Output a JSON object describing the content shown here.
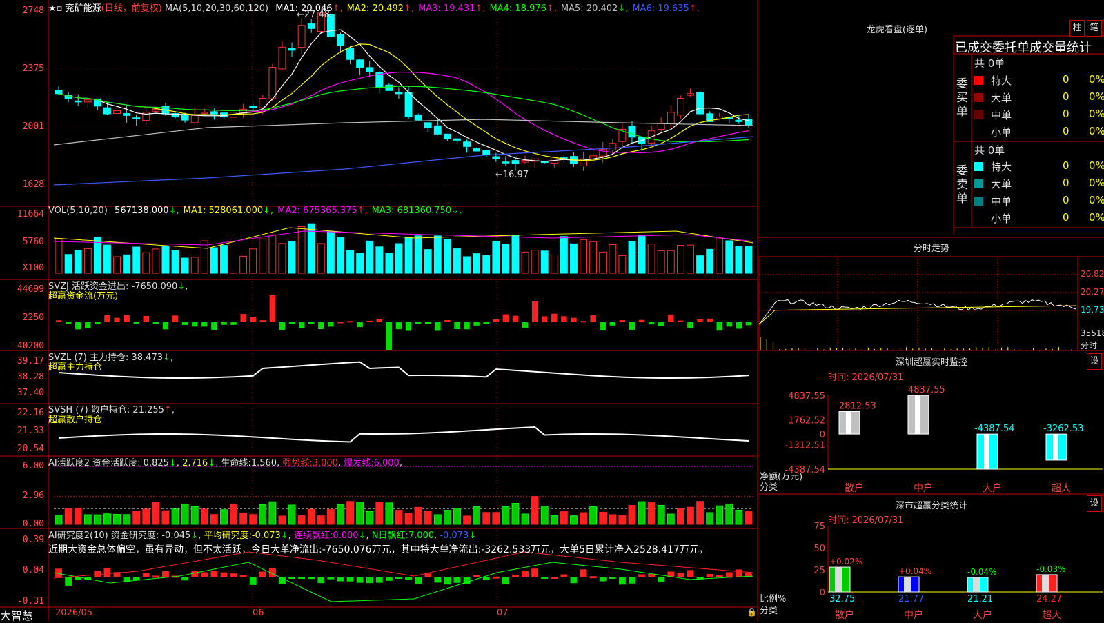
{
  "app": {
    "brand": "大智慧",
    "date_label": "2026/05",
    "month_labels": [
      "06",
      "07"
    ]
  },
  "stock": {
    "name": "兖矿能源",
    "mode": "(日线，前复权)"
  },
  "kline": {
    "ma_header": "MA(5,10,20,30,60,120)",
    "ma_values": [
      {
        "label": "MA1:",
        "value": "20.046",
        "arrow": "↑",
        "color": "#ffffff"
      },
      {
        "label": "MA2:",
        "value": "20.492",
        "arrow": "↑",
        "color": "#ffff00"
      },
      {
        "label": "MA3:",
        "value": "19.431",
        "arrow": "↑",
        "color": "#ff00ff"
      },
      {
        "label": "MA4:",
        "value": "18.976",
        "arrow": "↑",
        "color": "#00ff00"
      },
      {
        "label": "MA5:",
        "value": "20.402",
        "arrow": "↓",
        "color": "#c0c0c0"
      },
      {
        "label": "MA6:",
        "value": "19.635",
        "arrow": "↑",
        "color": "#3a5cff"
      }
    ],
    "high_label": "27.48",
    "low_label": "16.97",
    "y_ticks": [
      "2748",
      "2375",
      "2001",
      "1628"
    ]
  },
  "volume": {
    "header": "VOL(5,10,20)",
    "values": [
      {
        "label": "",
        "value": "567138.000",
        "arrow": "↓",
        "color": "#ffffff"
      },
      {
        "label": "MA1:",
        "value": "528061.000",
        "arrow": "↓",
        "color": "#ffff00"
      },
      {
        "label": "MA2:",
        "value": "675365.375",
        "arrow": "↑",
        "color": "#ff00ff"
      },
      {
        "label": "MA3:",
        "value": "681360.750",
        "arrow": "↓",
        "color": "#00ff00"
      }
    ],
    "y_ticks": [
      "11664",
      "5760"
    ],
    "unit": "X100"
  },
  "svzj": {
    "name": "SVZJ",
    "label": "活跃资金进出:",
    "value": "-7650.090",
    "arrow": "↓",
    "sub": "超赢资金流(万元)",
    "y_ticks": [
      "44699",
      "2250",
      "-40200"
    ]
  },
  "svzl": {
    "name": "SVZL",
    "param": "(7)",
    "label": "主力持仓:",
    "value": "38.473",
    "arrow": "↓",
    "sub": "超赢主力持仓",
    "y_ticks": [
      "39.17",
      "38.28",
      "37.40"
    ]
  },
  "svsh": {
    "name": "SVSH",
    "param": "(7)",
    "label": "散户持仓:",
    "value": "21.255",
    "arrow": "↑",
    "sub": "超赢散户持仓",
    "y_ticks": [
      "22.16",
      "21.33",
      "20.54"
    ]
  },
  "ai_active": {
    "name": "AI活跃度2",
    "label": "资金活跃度:",
    "v1": "0.825",
    "a1": "↓",
    "v2": "2.716",
    "a2": "↓",
    "life_label": "生命线:",
    "life": "1.560",
    "strong_label": "强势线:",
    "strong": "3.000",
    "burst_label": "爆发线:",
    "burst": "6.000",
    "y_ticks": [
      "6.00",
      "2.96",
      "0.00"
    ]
  },
  "ai_research": {
    "name": "AI研究度2(10)",
    "label": "资金研究度:",
    "value": "-0.045",
    "arrow": "↓",
    "avg_label": "平均研究度:",
    "avg": "-0.073",
    "avg_arrow": "↓",
    "cons_label": "连续飘红:",
    "cons": "0.000",
    "cons_arrow": "↓",
    "n_label": "N日飘红:",
    "n1": "7.000",
    "n2": "-0.073",
    "n_arrow": "↓",
    "comment": "近期大资金总体偏空，虽有异动，但不太活跃，今日大单净流出:-7650.076万元，其中特大单净流出:-3262.533万元，大单5日累计净入2528.417万元，",
    "y_ticks": [
      "0.39",
      "0.04",
      "-0.31"
    ]
  },
  "right": {
    "dragon_title": "龙虎看盘(逐单)",
    "btn_zhu": "柱",
    "btn_bi": "笔",
    "tabs": "已成交委托单成交量统计",
    "buy_group": {
      "side": "委买单",
      "total": "共 0单",
      "rows": [
        {
          "label": "特大",
          "count": "0",
          "pct": "0%",
          "color": "#ff0000"
        },
        {
          "label": "大单",
          "count": "0",
          "pct": "0%",
          "color": "#990000"
        },
        {
          "label": "中单",
          "count": "0",
          "pct": "0%",
          "color": "#660000"
        },
        {
          "label": "小单",
          "count": "0",
          "pct": "0%",
          "color": ""
        }
      ]
    },
    "sell_group": {
      "side": "委卖单",
      "total": "共 0单",
      "rows": [
        {
          "label": "特大",
          "count": "0",
          "pct": "0%",
          "color": "#00ffff"
        },
        {
          "label": "大单",
          "count": "0",
          "pct": "0%",
          "color": "#009999"
        },
        {
          "label": "中单",
          "count": "0",
          "pct": "0%",
          "color": "#008080"
        },
        {
          "label": "小单",
          "count": "0",
          "pct": "0%",
          "color": ""
        }
      ]
    },
    "intraday": {
      "title": "分时走势",
      "prices": [
        "20.82",
        "20.27",
        "19.73"
      ],
      "vol": "35518",
      "vol_unit": "分时"
    },
    "monitor": {
      "title": "深圳超赢实时监控",
      "btn": "设",
      "time": "时间: 2026/07/31",
      "y_ticks": [
        "4837.55",
        "1762.52",
        "0",
        "-1312.51",
        "-4387.54"
      ],
      "unit": "净额(万元)",
      "cat_label": "分类"
    },
    "stats": {
      "title": "深市超赢分类统计",
      "btn": "设",
      "time": "时间: 2026/07/31",
      "y_ticks": [
        "75",
        "50",
        "25",
        "0"
      ],
      "unit": "比例%",
      "cat_label": "分类"
    }
  },
  "chart_data": [
    {
      "type": "bar",
      "title": "深圳超赢实时监控",
      "ylabel": "净额(万元)",
      "categories": [
        "散户",
        "中户",
        "大户",
        "超大"
      ],
      "values": [
        2812.53,
        4837.55,
        -4387.54,
        -3262.53
      ],
      "value_labels": [
        "2812.53",
        "4837.55",
        "-4387.54",
        "-3262.53"
      ],
      "ylim": [
        -4387.54,
        4837.55
      ]
    },
    {
      "type": "bar",
      "title": "深市超赢分类统计",
      "ylabel": "比例%",
      "categories": [
        "散户",
        "中户",
        "大户",
        "超大"
      ],
      "values": [
        32.75,
        21.77,
        21.21,
        24.27
      ],
      "value_labels": [
        "32.75",
        "21.77",
        "21.21",
        "24.27"
      ],
      "change_labels": [
        "+0.02%",
        "+0.04%",
        "-0.04%",
        "-0.03%"
      ],
      "ylim": [
        0,
        75
      ]
    },
    {
      "type": "line",
      "title": "兖矿能源",
      "xlabel": "",
      "ylabel": "",
      "x": [
        "2026/05",
        "06",
        "07"
      ],
      "series": [
        {
          "name": "MA1",
          "values": [
            20.046
          ]
        },
        {
          "name": "MA2",
          "values": [
            20.492
          ]
        },
        {
          "name": "MA3",
          "values": [
            19.431
          ]
        },
        {
          "name": "MA4",
          "values": [
            18.976
          ]
        },
        {
          "name": "MA5",
          "values": [
            20.402
          ]
        },
        {
          "name": "MA6",
          "values": [
            19.635
          ]
        }
      ],
      "ylim": [
        16.28,
        27.48
      ],
      "annotations": [
        "27.48",
        "16.97"
      ]
    }
  ]
}
